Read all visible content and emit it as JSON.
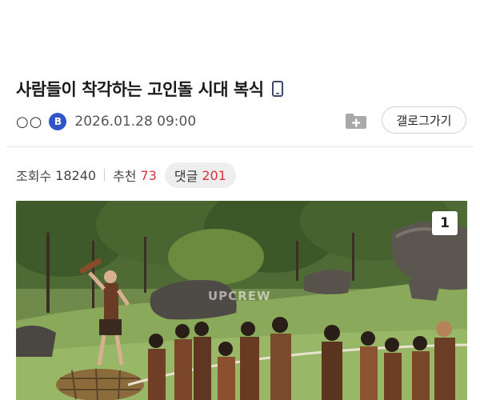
{
  "post": {
    "title": "사람들이 착각하는 고인돌 시대 복식",
    "author": "○○",
    "level_badge": "B",
    "date": "2026.01.28 09:00"
  },
  "actions": {
    "gallery_label": "갤로그가기"
  },
  "stats": {
    "views_label": "조회수",
    "views": "18240",
    "recommend_label": "추천",
    "recommend": "73",
    "comments_label": "댓글",
    "comments": "201"
  },
  "image": {
    "counter": "1",
    "watermark": "UPCREW"
  },
  "colors": {
    "accent_red": "#d6343b",
    "badge_blue": "#2f55c8"
  }
}
